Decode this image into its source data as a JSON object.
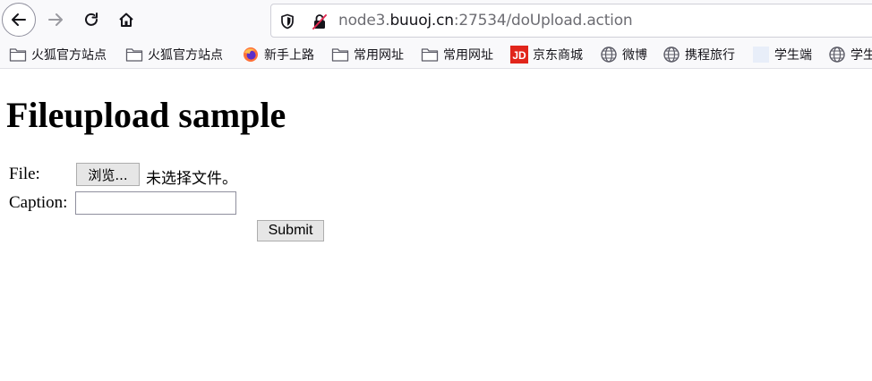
{
  "browser": {
    "url_host_prefix": "node3.",
    "url_host_main": "buuoj.cn",
    "url_rest": ":27534/doUpload.action",
    "icons": [
      "back-arrow-icon",
      "forward-arrow-icon",
      "reload-icon",
      "home-icon",
      "shield-icon",
      "insecure-lock-icon"
    ]
  },
  "bookmarks": [
    {
      "label": "火狐官方站点",
      "icon": "folder-icon"
    },
    {
      "label": "火狐官方站点",
      "icon": "folder-icon"
    },
    {
      "label": "新手上路",
      "icon": "firefox-icon"
    },
    {
      "label": "常用网址",
      "icon": "folder-icon"
    },
    {
      "label": "常用网址",
      "icon": "folder-icon"
    },
    {
      "label": "京东商城",
      "icon": "jd-icon"
    },
    {
      "label": "微博",
      "icon": "globe-icon"
    },
    {
      "label": "携程旅行",
      "icon": "globe-icon"
    },
    {
      "label": "学生端",
      "icon": "blank-page-icon"
    },
    {
      "label": "学生",
      "icon": "globe-icon"
    }
  ],
  "page": {
    "title": "Fileupload sample",
    "file_label": "File:",
    "browse_label": "浏览...",
    "no_file_text": "未选择文件。",
    "caption_label": "Caption:",
    "caption_value": "",
    "submit_label": "Submit"
  },
  "colors": {
    "toolbar_bg": "#f9f9fb",
    "jd_red": "#e1251b",
    "button_bg": "#e6e6e6"
  }
}
